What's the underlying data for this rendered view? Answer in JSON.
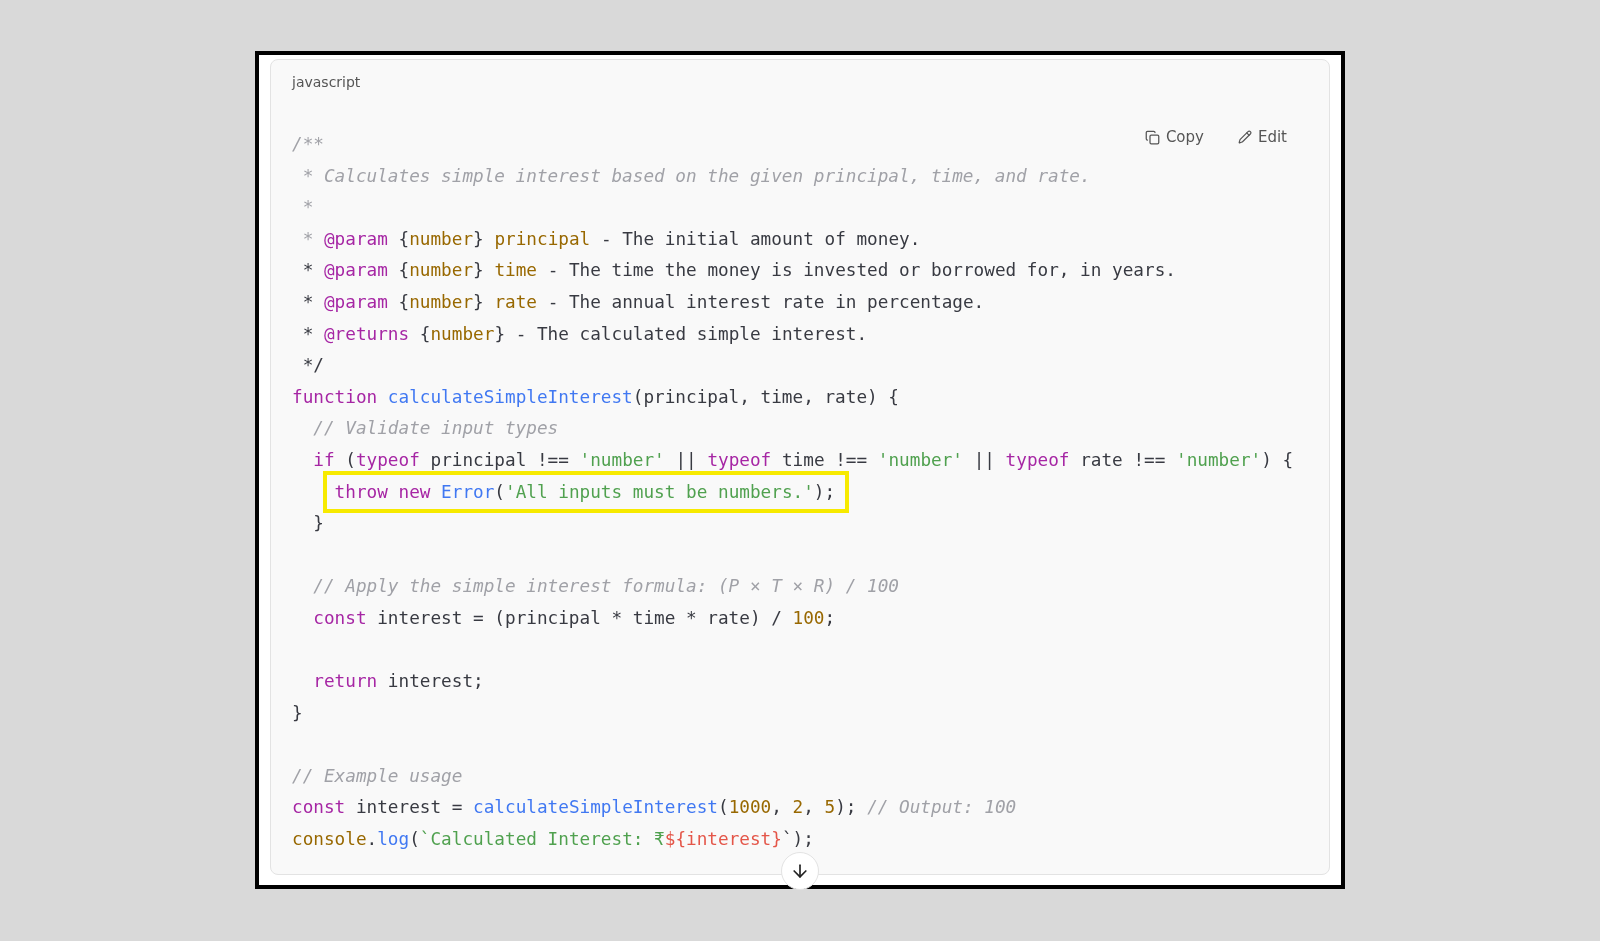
{
  "code_block": {
    "language": "javascript",
    "actions": [
      {
        "kind": "copy",
        "label": "Copy"
      },
      {
        "kind": "edit",
        "label": "Edit"
      }
    ],
    "lines": [
      {
        "kind": "code",
        "highlighted": false,
        "tokens": [
          {
            "kind": "comment",
            "text": "/**"
          }
        ]
      },
      {
        "kind": "code",
        "highlighted": false,
        "tokens": [
          {
            "kind": "comment",
            "text": " * Calculates simple interest based on the given principal, time, and rate."
          }
        ]
      },
      {
        "kind": "code",
        "highlighted": false,
        "tokens": [
          {
            "kind": "comment",
            "text": " *"
          }
        ]
      },
      {
        "kind": "code",
        "highlighted": false,
        "tokens": [
          {
            "kind": "comment",
            "text": " * "
          },
          {
            "kind": "tag",
            "text": "@param"
          },
          {
            "kind": "plain",
            "text": " {"
          },
          {
            "kind": "type",
            "text": "number"
          },
          {
            "kind": "plain",
            "text": "} "
          },
          {
            "kind": "param",
            "text": "principal"
          },
          {
            "kind": "plain",
            "text": " - The initial amount of money."
          }
        ]
      },
      {
        "kind": "code",
        "highlighted": false,
        "tokens": [
          {
            "kind": "plain",
            "text": " * "
          },
          {
            "kind": "tag",
            "text": "@param"
          },
          {
            "kind": "plain",
            "text": " {"
          },
          {
            "kind": "type",
            "text": "number"
          },
          {
            "kind": "plain",
            "text": "} "
          },
          {
            "kind": "param",
            "text": "time"
          },
          {
            "kind": "plain",
            "text": " - The time the money is invested or borrowed for, in years."
          }
        ]
      },
      {
        "kind": "code",
        "highlighted": false,
        "tokens": [
          {
            "kind": "plain",
            "text": " * "
          },
          {
            "kind": "tag",
            "text": "@param"
          },
          {
            "kind": "plain",
            "text": " {"
          },
          {
            "kind": "type",
            "text": "number"
          },
          {
            "kind": "plain",
            "text": "} "
          },
          {
            "kind": "param",
            "text": "rate"
          },
          {
            "kind": "plain",
            "text": " - The annual interest rate in percentage."
          }
        ]
      },
      {
        "kind": "code",
        "highlighted": false,
        "tokens": [
          {
            "kind": "plain",
            "text": " * "
          },
          {
            "kind": "tag",
            "text": "@returns"
          },
          {
            "kind": "plain",
            "text": " {"
          },
          {
            "kind": "type",
            "text": "number"
          },
          {
            "kind": "plain",
            "text": "} - The calculated simple interest."
          }
        ]
      },
      {
        "kind": "code",
        "highlighted": false,
        "tokens": [
          {
            "kind": "plain",
            "text": " */"
          }
        ]
      },
      {
        "kind": "code",
        "highlighted": false,
        "tokens": [
          {
            "kind": "keyword",
            "text": "function "
          },
          {
            "kind": "function",
            "text": "calculateSimpleInterest"
          },
          {
            "kind": "plain",
            "text": "(principal, time, rate) {"
          }
        ]
      },
      {
        "kind": "code",
        "highlighted": false,
        "tokens": [
          {
            "kind": "comment",
            "text": "  // Validate input types"
          }
        ]
      },
      {
        "kind": "code",
        "highlighted": false,
        "tokens": [
          {
            "kind": "keyword",
            "text": "  if"
          },
          {
            "kind": "plain",
            "text": " ("
          },
          {
            "kind": "keyword",
            "text": "typeof"
          },
          {
            "kind": "plain",
            "text": " principal !== "
          },
          {
            "kind": "string",
            "text": "'number'"
          },
          {
            "kind": "plain",
            "text": " || "
          },
          {
            "kind": "keyword",
            "text": "typeof"
          },
          {
            "kind": "plain",
            "text": " time !== "
          },
          {
            "kind": "string",
            "text": "'number'"
          },
          {
            "kind": "plain",
            "text": " || "
          },
          {
            "kind": "keyword",
            "text": "typeof"
          },
          {
            "kind": "plain",
            "text": " rate !== "
          },
          {
            "kind": "string",
            "text": "'number'"
          },
          {
            "kind": "plain",
            "text": ") {"
          }
        ]
      },
      {
        "kind": "code",
        "highlighted": true,
        "tokens": [
          {
            "kind": "keyword",
            "text": "    throw new "
          },
          {
            "kind": "function",
            "text": "Error"
          },
          {
            "kind": "plain",
            "text": "("
          },
          {
            "kind": "string",
            "text": "'All inputs must be numbers.'"
          },
          {
            "kind": "plain",
            "text": ");"
          }
        ]
      },
      {
        "kind": "code",
        "highlighted": false,
        "tokens": [
          {
            "kind": "plain",
            "text": "  }"
          }
        ]
      },
      {
        "kind": "blank",
        "highlighted": false
      },
      {
        "kind": "code",
        "highlighted": false,
        "tokens": [
          {
            "kind": "comment",
            "text": "  // Apply the simple interest formula: (P × T × R) / 100"
          }
        ]
      },
      {
        "kind": "code",
        "highlighted": false,
        "tokens": [
          {
            "kind": "keyword",
            "text": "  const"
          },
          {
            "kind": "plain",
            "text": " interest = (principal * time * rate) / "
          },
          {
            "kind": "number",
            "text": "100"
          },
          {
            "kind": "plain",
            "text": ";"
          }
        ]
      },
      {
        "kind": "blank",
        "highlighted": false
      },
      {
        "kind": "code",
        "highlighted": false,
        "tokens": [
          {
            "kind": "keyword",
            "text": "  return"
          },
          {
            "kind": "plain",
            "text": " interest;"
          }
        ]
      },
      {
        "kind": "code",
        "highlighted": false,
        "tokens": [
          {
            "kind": "plain",
            "text": "}"
          }
        ]
      },
      {
        "kind": "blank",
        "highlighted": false
      },
      {
        "kind": "code",
        "highlighted": false,
        "tokens": [
          {
            "kind": "comment",
            "text": "// Example usage"
          }
        ]
      },
      {
        "kind": "code",
        "highlighted": false,
        "tokens": [
          {
            "kind": "keyword",
            "text": "const"
          },
          {
            "kind": "plain",
            "text": " interest = "
          },
          {
            "kind": "function",
            "text": "calculateSimpleInterest"
          },
          {
            "kind": "plain",
            "text": "("
          },
          {
            "kind": "number",
            "text": "1000"
          },
          {
            "kind": "plain",
            "text": ", "
          },
          {
            "kind": "number",
            "text": "2"
          },
          {
            "kind": "plain",
            "text": ", "
          },
          {
            "kind": "number",
            "text": "5"
          },
          {
            "kind": "plain",
            "text": "); "
          },
          {
            "kind": "comment",
            "text": "// Output: 100"
          }
        ]
      },
      {
        "kind": "code",
        "highlighted": false,
        "tokens": [
          {
            "kind": "type",
            "text": "console"
          },
          {
            "kind": "plain",
            "text": "."
          },
          {
            "kind": "function",
            "text": "log"
          },
          {
            "kind": "plain",
            "text": "("
          },
          {
            "kind": "string",
            "text": "`Calculated Interest: ₹"
          },
          {
            "kind": "interp",
            "text": "${interest}"
          },
          {
            "kind": "plain",
            "text": "`);"
          }
        ]
      }
    ]
  }
}
